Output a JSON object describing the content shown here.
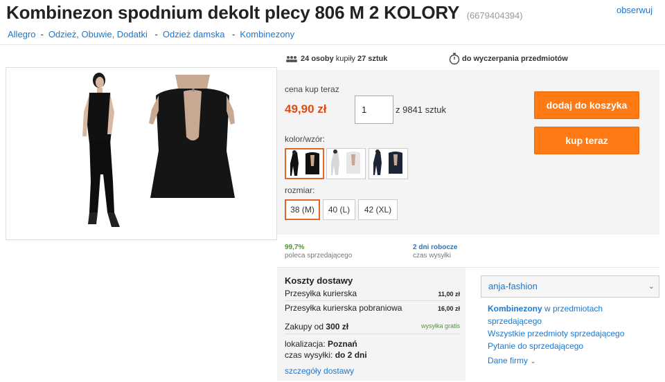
{
  "header": {
    "title": "Kombinezon spodnium dekolt plecy 806 M 2 KOLORY",
    "offer_id": "(6679404394)",
    "watch_label": "obserwuj"
  },
  "breadcrumb": [
    "Allegro",
    "Odzież, Obuwie, Dodatki",
    "Odzież damska",
    "Kombinezony"
  ],
  "buyers": {
    "count": "24",
    "persons_label": "osoby",
    "bought_label": "kupiły",
    "items": "27 sztuk"
  },
  "stock_time": "do wyczerpania przedmiotów",
  "buy_box": {
    "price_label": "cena kup teraz",
    "price": "49,90 zł",
    "quantity": "1",
    "quantity_of": "z 9841 sztuk",
    "add_to_cart": "dodaj do koszyka",
    "buy_now": "kup teraz",
    "color_label": "kolor/wzór:",
    "size_label": "rozmiar:",
    "sizes": [
      "38 (M)",
      "40 (L)",
      "42 (XL)"
    ],
    "selected_size": "38 (M)"
  },
  "stats": {
    "recommend_value": "99,7%",
    "recommend_label": "poleca sprzedającego",
    "shipping_time_value": "2 dni robocze",
    "shipping_time_label": "czas wysyłki"
  },
  "delivery": {
    "heading": "Koszty dostawy",
    "courier_label": "Przesyłka kurierska",
    "courier_price": "11,00 zł",
    "cod_label": "Przesyłka kurierska pobraniowa",
    "cod_price": "16,00 zł",
    "free_prefix": "Zakupy od",
    "free_amount": "300 zł",
    "free_label": "wysyłka gratis",
    "location_label": "lokalizacja:",
    "location_value": "Poznań",
    "dispatch_label": "czas wysyłki:",
    "dispatch_value": "do 2 dni",
    "details_link": "szczegóły dostawy"
  },
  "seller": {
    "name": "anja-fashion",
    "category_bold": "Kombinezony",
    "category_rest": " w przedmiotach sprzedającego",
    "all_items": "Wszystkie przedmioty sprzedającego",
    "ask": "Pytanie do sprzedającego",
    "company_data": "Dane firmy"
  },
  "colors": {
    "accent": "#ff7a14",
    "price": "#e04b0f",
    "link": "#1a77d2",
    "green": "#4a9a2c"
  }
}
